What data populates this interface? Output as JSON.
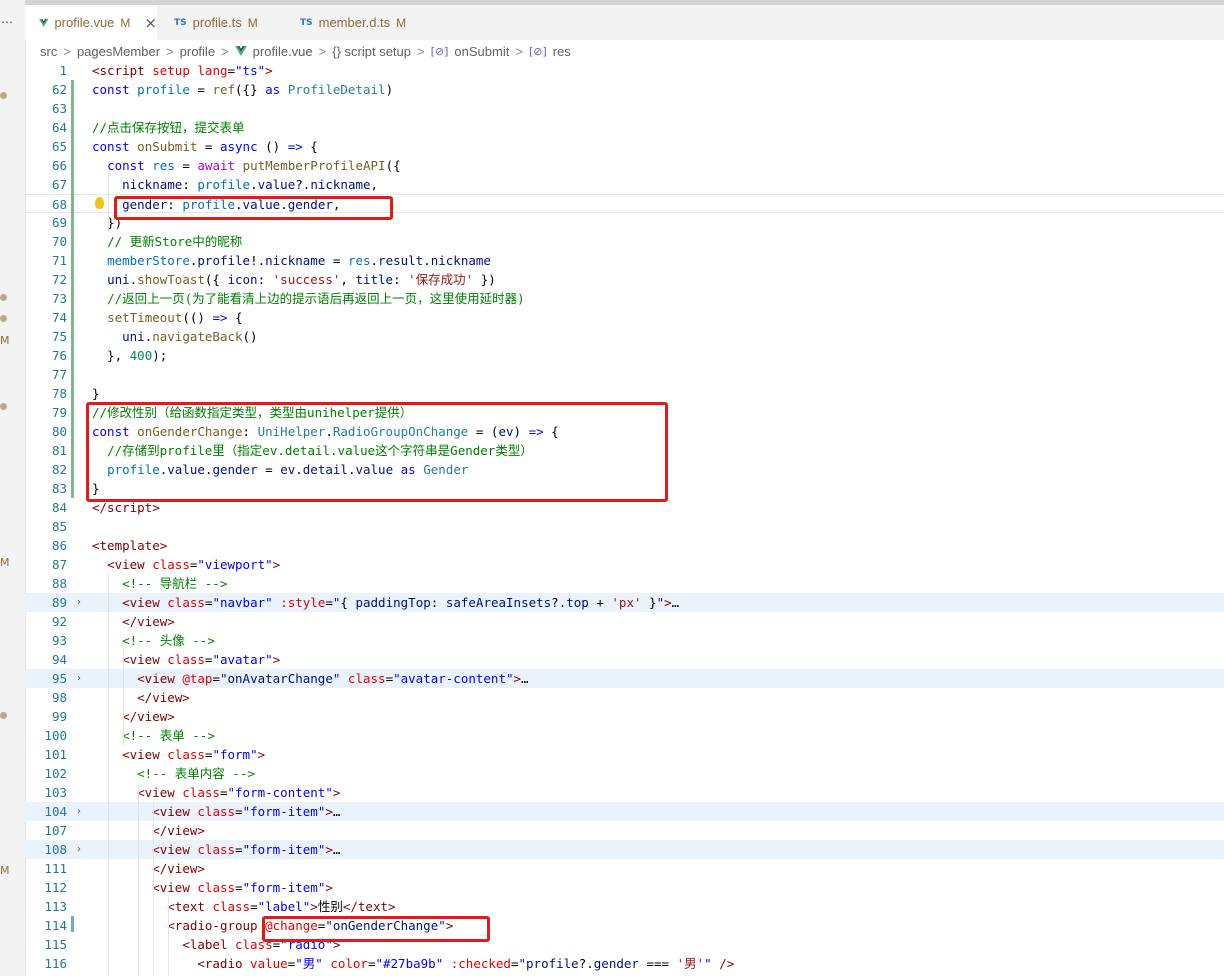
{
  "tabs": [
    {
      "name": "profile.vue",
      "badge": "M",
      "icon": "vue-icon",
      "active": true
    },
    {
      "name": "profile.ts",
      "badge": "M",
      "icon": "ts-icon"
    },
    {
      "name": "member.d.ts",
      "badge": "M",
      "icon": "ts-icon"
    }
  ],
  "tab_close_glyph": "×",
  "breadcrumbs": {
    "items": [
      "src",
      "pagesMember",
      "profile",
      "profile.vue",
      "{} script setup",
      "onSubmit",
      "res"
    ],
    "separator": ">"
  },
  "activity_markers": {
    "top": "…",
    "m": "M"
  },
  "code": {
    "lines": [
      {
        "n": "1",
        "html": "<span style='color:#800000'>&lt;script</span> <span style='color:#e50000'>setup</span> <span style='color:#e50000'>lang</span>=<span style='color:#0000ff'>\"ts\"</span><span style='color:#800000'>&gt;</span>"
      },
      {
        "n": "62",
        "html": "<span style='color:#0000ff'>const</span> <span style='color:#0070c1'>profile</span> = <span style='color:#795e26'>ref</span>({} <span style='color:#0000ff'>as</span> <span style='color:#267f99'>ProfileDetail</span>)"
      },
      {
        "n": "63",
        "html": ""
      },
      {
        "n": "64",
        "html": "<span style='color:#008000'>//点击保存按钮，提交表单</span>"
      },
      {
        "n": "65",
        "html": "<span style='color:#0000ff'>const</span> <span style='color:#795e26'>onSubmit</span> = <span style='color:#0000ff'>async</span> () <span style='color:#0000ff'>=&gt;</span> {"
      },
      {
        "n": "66",
        "html": "  <span style='color:#0000ff'>const</span> <span style='color:#0070c1'>res</span> = <span style='color:#af00db'>await</span> <span style='color:#795e26'>putMemberProfileAPI</span>({"
      },
      {
        "n": "67",
        "html": "    <span style='color:#001080'>nickname</span>: <span style='color:#0070c1'>profile</span>.<span style='color:#001080'>value</span>?.<span style='color:#001080'>nickname</span>,"
      },
      {
        "n": "68",
        "html": "    <span style='color:#001080'>gender</span>: <span style='color:#0070c1'>profile</span>.<span style='color:#001080'>value</span>.<span style='color:#001080'>gender</span>,"
      },
      {
        "n": "69",
        "html": "  })"
      },
      {
        "n": "70",
        "html": "  <span style='color:#008000'>// 更新Store中的昵称</span>"
      },
      {
        "n": "71",
        "html": "  <span style='color:#0070c1'>memberStore</span>.<span style='color:#001080'>profile</span>!.<span style='color:#001080'>nickname</span> = <span style='color:#0070c1'>res</span>.<span style='color:#001080'>result</span>.<span style='color:#001080'>nickname</span>"
      },
      {
        "n": "72",
        "html": "  <span style='color:#001080'>uni</span>.<span style='color:#795e26'>showToast</span>({ <span style='color:#001080'>icon</span>: <span style='color:#a31515'>'success'</span>, <span style='color:#001080'>title</span>: <span style='color:#a31515'>'保存成功'</span> })"
      },
      {
        "n": "73",
        "html": "  <span style='color:#008000'>//返回上一页(为了能看清上边的提示语后再返回上一页，这里使用延时器)</span>"
      },
      {
        "n": "74",
        "html": "  <span style='color:#795e26'>setTimeout</span>(() <span style='color:#0000ff'>=&gt;</span> {"
      },
      {
        "n": "75",
        "html": "    <span style='color:#001080'>uni</span>.<span style='color:#795e26'>navigateBack</span>()"
      },
      {
        "n": "76",
        "html": "  }, <span style='color:#098658'>400</span>);"
      },
      {
        "n": "77",
        "html": ""
      },
      {
        "n": "78",
        "html": "}"
      },
      {
        "n": "79",
        "html": "<span style='color:#008000'>//修改性别（给函数指定类型，类型由unihelper提供）</span>"
      },
      {
        "n": "80",
        "html": "<span style='color:#0000ff'>const</span> <span style='color:#795e26'>onGenderChange</span>: <span style='color:#267f99'>UniHelper</span>.<span style='color:#267f99'>RadioGroupOnChange</span> = (<span style='color:#001080'>ev</span>) <span style='color:#0000ff'>=&gt;</span> {"
      },
      {
        "n": "81",
        "html": "  <span style='color:#008000'>//存储到profile里（指定ev.detail.value这个字符串是Gender类型）</span>"
      },
      {
        "n": "82",
        "html": "  <span style='color:#0070c1'>profile</span>.<span style='color:#001080'>value</span>.<span style='color:#001080'>gender</span> = <span style='color:#001080'>ev</span>.<span style='color:#001080'>detail</span>.<span style='color:#001080'>value</span> <span style='color:#0000ff'>as</span> <span style='color:#267f99'>Gender</span>"
      },
      {
        "n": "83",
        "html": "}"
      },
      {
        "n": "84",
        "html": "<span style='color:#800000'>&lt;/script&gt;</span>"
      },
      {
        "n": "85",
        "html": ""
      },
      {
        "n": "86",
        "html": "<span style='color:#800000'>&lt;template&gt;</span>"
      },
      {
        "n": "87",
        "html": "  <span style='color:#800000'>&lt;view</span> <span style='color:#e50000'>class</span>=<span style='color:#0000ff'>\"viewport\"</span><span style='color:#800000'>&gt;</span>"
      },
      {
        "n": "88",
        "html": "    <span style='color:#008000'>&lt;!-- 导航栏 --&gt;</span>"
      },
      {
        "n": "89",
        "html": "    <span style='color:#800000'>&lt;view</span> <span style='color:#e50000'>class</span>=<span style='color:#0000ff'>\"navbar\"</span> <span style='color:#e50000'>:style</span>=<span style='color:#0000ff'>\"</span>{ <span style='color:#001080'>paddingTop</span>: <span style='color:#001080'>safeAreaInsets</span>?.<span style='color:#001080'>top</span> + <span style='color:#a31515'>'px'</span> }<span style='color:#0000ff'>\"</span><span style='color:#800000'>&gt;</span>…",
        "fold": true,
        "hl": true
      },
      {
        "n": "92",
        "html": "    <span style='color:#800000'>&lt;/view&gt;</span>"
      },
      {
        "n": "93",
        "html": "    <span style='color:#008000'>&lt;!-- 头像 --&gt;</span>"
      },
      {
        "n": "94",
        "html": "    <span style='color:#800000'>&lt;view</span> <span style='color:#e50000'>class</span>=<span style='color:#0000ff'>\"avatar\"</span><span style='color:#800000'>&gt;</span>"
      },
      {
        "n": "95",
        "html": "      <span style='color:#800000'>&lt;view</span> <span style='color:#e50000'>@tap</span>=<span style='color:#0000ff'>\"</span><span style='color:#001080'>onAvatarChange</span><span style='color:#0000ff'>\"</span> <span style='color:#e50000'>class</span>=<span style='color:#0000ff'>\"avatar-content\"</span><span style='color:#800000'>&gt;</span>…",
        "fold": true,
        "hl": true
      },
      {
        "n": "98",
        "html": "      <span style='color:#800000'>&lt;/view&gt;</span>"
      },
      {
        "n": "99",
        "html": "    <span style='color:#800000'>&lt;/view&gt;</span>"
      },
      {
        "n": "100",
        "html": "    <span style='color:#008000'>&lt;!-- 表单 --&gt;</span>"
      },
      {
        "n": "101",
        "html": "    <span style='color:#800000'>&lt;view</span> <span style='color:#e50000'>class</span>=<span style='color:#0000ff'>\"form\"</span><span style='color:#800000'>&gt;</span>"
      },
      {
        "n": "102",
        "html": "      <span style='color:#008000'>&lt;!-- 表单内容 --&gt;</span>"
      },
      {
        "n": "103",
        "html": "      <span style='color:#800000'>&lt;view</span> <span style='color:#e50000'>class</span>=<span style='color:#0000ff'>\"form-content\"</span><span style='color:#800000'>&gt;</span>"
      },
      {
        "n": "104",
        "html": "        <span style='color:#800000'>&lt;view</span> <span style='color:#e50000'>class</span>=<span style='color:#0000ff'>\"form-item\"</span><span style='color:#800000'>&gt;</span>…",
        "fold": true,
        "hl": true
      },
      {
        "n": "107",
        "html": "        <span style='color:#800000'>&lt;/view&gt;</span>"
      },
      {
        "n": "108",
        "html": "        <span style='color:#800000'>&lt;view</span> <span style='color:#e50000'>class</span>=<span style='color:#0000ff'>\"form-item\"</span><span style='color:#800000'>&gt;</span>…",
        "fold": true,
        "hl": true
      },
      {
        "n": "111",
        "html": "        <span style='color:#800000'>&lt;/view&gt;</span>"
      },
      {
        "n": "112",
        "html": "        <span style='color:#800000'>&lt;view</span> <span style='color:#e50000'>class</span>=<span style='color:#0000ff'>\"form-item\"</span><span style='color:#800000'>&gt;</span>"
      },
      {
        "n": "113",
        "html": "          <span style='color:#800000'>&lt;text</span> <span style='color:#e50000'>class</span>=<span style='color:#0000ff'>\"label\"</span><span style='color:#800000'>&gt;</span>性别<span style='color:#800000'>&lt;/text&gt;</span>"
      },
      {
        "n": "114",
        "html": "          <span style='color:#800000'>&lt;radio-group</span> <span style='color:#e50000'>@change</span>=<span style='color:#0000ff'>\"</span><span style='color:#001080'>onGenderChange</span><span style='color:#0000ff'>\"</span><span style='color:#800000'>&gt;</span>"
      },
      {
        "n": "115",
        "html": "            <span style='color:#800000'>&lt;label</span> <span style='color:#e50000'>class</span>=<span style='color:#0000ff'>\"radio\"</span><span style='color:#800000'>&gt;</span>"
      },
      {
        "n": "116",
        "html": "              <span style='color:#800000'>&lt;radio</span> <span style='color:#e50000'>value</span>=<span style='color:#0000ff'>\"男\"</span> <span style='color:#e50000'>color</span>=<span style='color:#0000ff'>\"#27ba9b\"</span> <span style='color:#e50000'>:checked</span>=<span style='color:#0000ff'>\"</span><span style='color:#001080'>profile</span>?.<span style='color:#001080'>gender</span> === <span style='color:#a31515'>'男'</span><span style='color:#0000ff'>\"</span> <span style='color:#800000'>/&gt;</span>"
      }
    ]
  },
  "colors": {
    "annotation": "#e31a1a",
    "gutter_modified": "#81b88b",
    "line_number": "#237893"
  }
}
